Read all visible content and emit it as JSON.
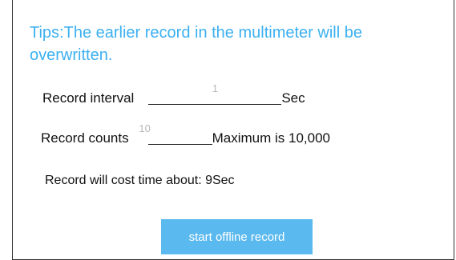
{
  "tips": {
    "text": "Tips:The earlier record in the multimeter will be overwritten."
  },
  "interval": {
    "label": "Record interval",
    "value": "1",
    "unit": "Sec"
  },
  "counts": {
    "label": "Record counts",
    "value": "10",
    "max_note": "Maximum is 10,000"
  },
  "cost": {
    "text": "Record will cost time about: 9Sec"
  },
  "actions": {
    "start_label": "start offline record"
  },
  "colors": {
    "accent": "#3cb0f0",
    "button_bg": "#5ab9ee",
    "placeholder": "#b8b8b8"
  }
}
